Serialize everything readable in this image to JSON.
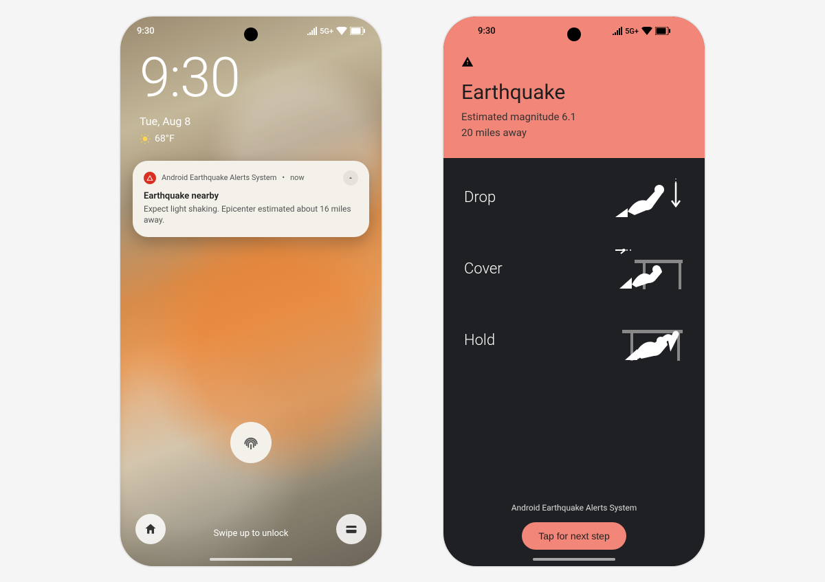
{
  "status_bar": {
    "time": "9:30",
    "network_label": "5G+",
    "signal_icon": "signal-icon",
    "wifi_icon": "wifi-icon",
    "battery_icon": "battery-icon"
  },
  "lockscreen": {
    "clock": "9:30",
    "date": "Tue, Aug 8",
    "weather_icon": "sun-icon",
    "temperature": "68°F",
    "notification": {
      "app_name": "Android Earthquake Alerts System",
      "time": "now",
      "title": "Earthquake nearby",
      "body": "Expect light shaking. Epicenter estimated about 16 miles away."
    },
    "unlock_hint": "Swipe up to unlock"
  },
  "alert_screen": {
    "title": "Earthquake",
    "magnitude_line": "Estimated magnitude 6.1",
    "distance_line": "20 miles away",
    "instructions": [
      {
        "label": "Drop"
      },
      {
        "label": "Cover"
      },
      {
        "label": "Hold"
      }
    ],
    "footer_label": "Android Earthquake Alerts System",
    "next_button": "Tap for next step"
  },
  "colors": {
    "alert_coral": "#f28779",
    "alert_dark": "#1e2024",
    "notif_bg": "#f4f1eb",
    "alert_red": "#d93025"
  }
}
